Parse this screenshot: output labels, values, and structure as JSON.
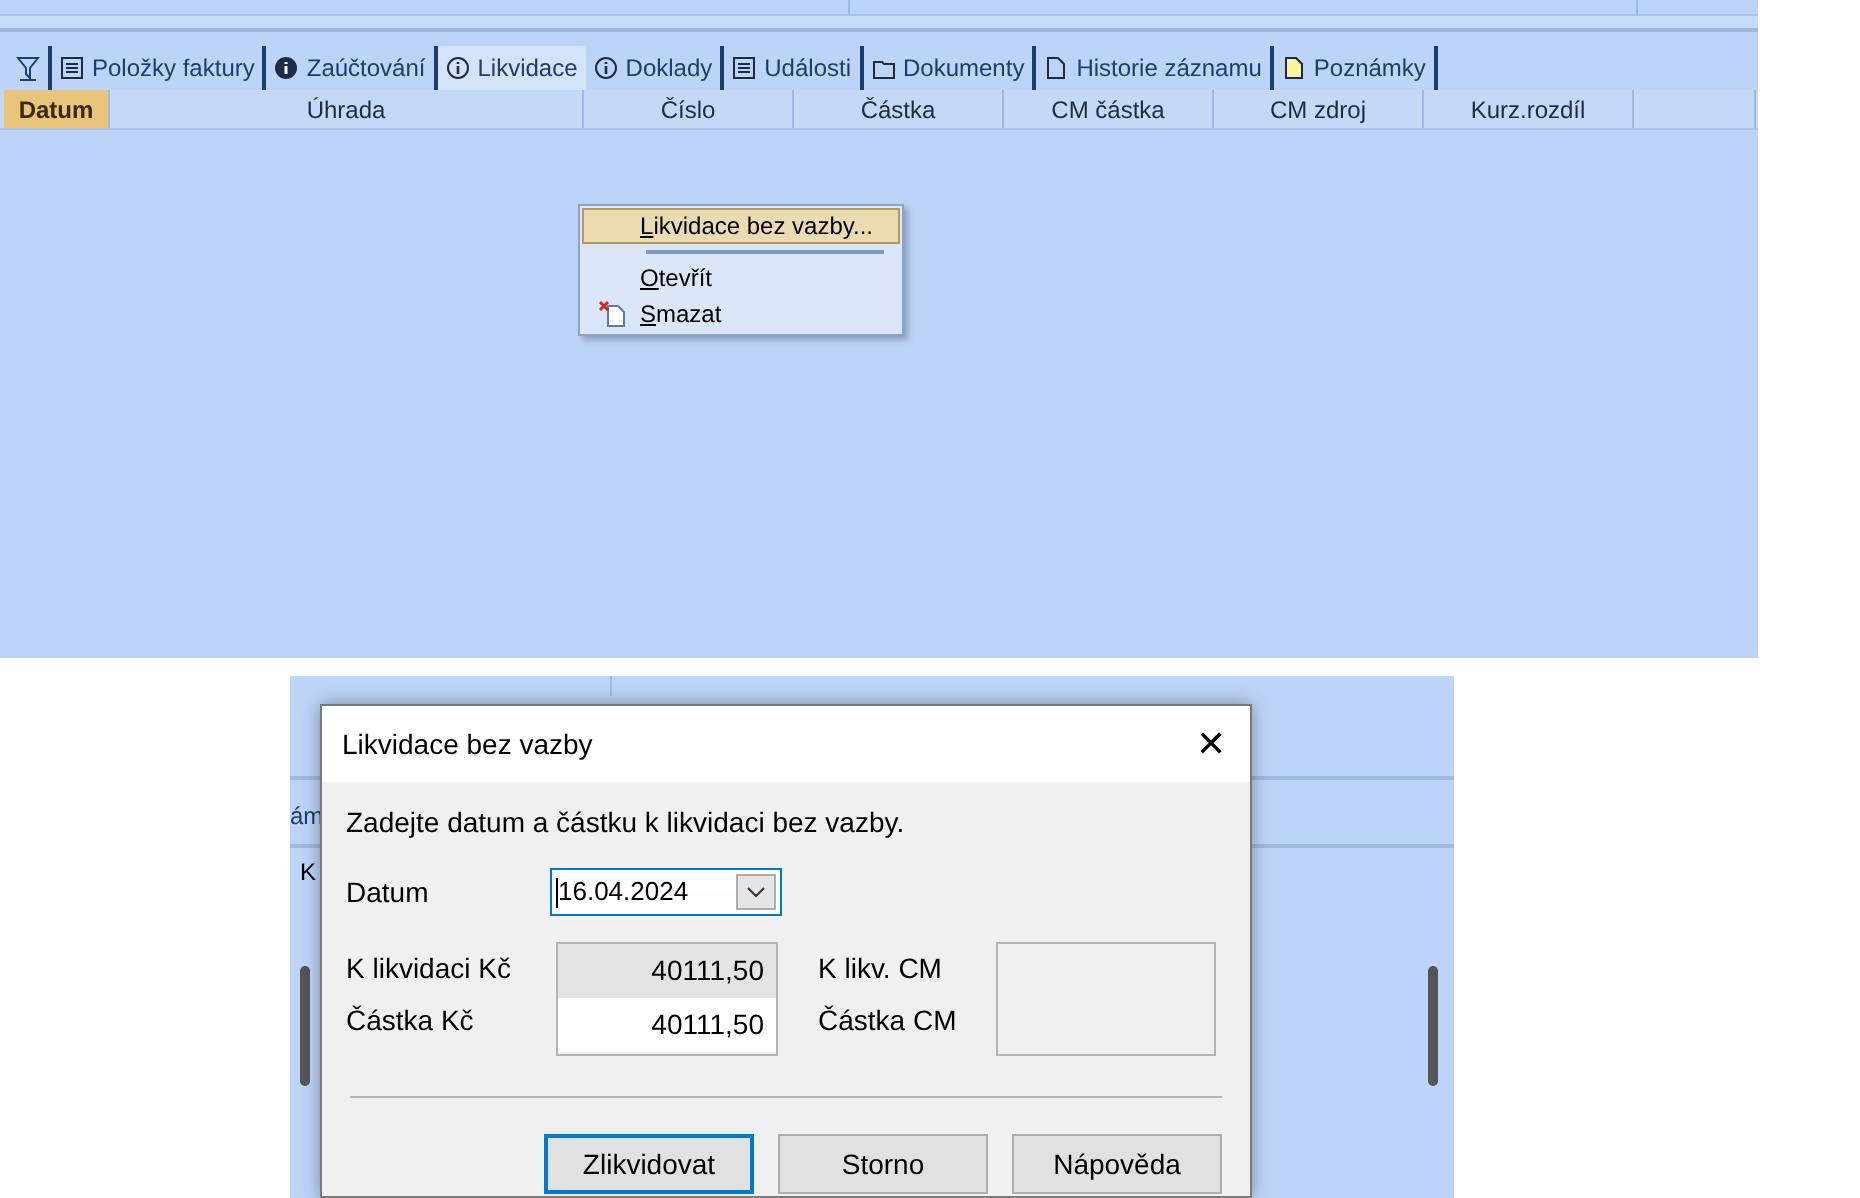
{
  "tabs": [
    {
      "kind": "filter",
      "selected": false
    },
    {
      "kind": "list",
      "label": "Položky faktury",
      "selected": false
    },
    {
      "kind": "info-solid",
      "label": "Zaúčtování",
      "selected": false
    },
    {
      "kind": "info",
      "label": "Likvidace",
      "selected": true
    },
    {
      "kind": "info",
      "label": "Doklady",
      "selected": false
    },
    {
      "kind": "list",
      "label": "Události",
      "selected": false
    },
    {
      "kind": "folder",
      "label": "Dokumenty",
      "selected": false
    },
    {
      "kind": "doc",
      "label": "Historie záznamu",
      "selected": false
    },
    {
      "kind": "note",
      "label": "Poznámky",
      "selected": false
    }
  ],
  "table": {
    "columns": [
      {
        "label": "Datum",
        "selected": true
      },
      {
        "label": "Úhrada",
        "selected": false
      },
      {
        "label": "Číslo",
        "selected": false
      },
      {
        "label": "Částka",
        "selected": false
      },
      {
        "label": "CM částka",
        "selected": false
      },
      {
        "label": "CM zdroj",
        "selected": false
      },
      {
        "label": "Kurz.rozdíl",
        "selected": false
      }
    ]
  },
  "context_menu": {
    "items": [
      {
        "kind": "plain",
        "label": "Likvidace bez vazby...",
        "selected": true
      },
      {
        "kind": "plain",
        "label": "Otevřít",
        "selected": false
      },
      {
        "kind": "delete",
        "label": "Smazat",
        "selected": false
      }
    ]
  },
  "background_fragments": [
    "ám",
    "K"
  ],
  "dialog": {
    "title": "Likvidace bez vazby",
    "close": "✕",
    "instruction": "Zadejte datum a částku k likvidaci bez vazby.",
    "date": {
      "label": "Datum",
      "value": "16.04.2024"
    },
    "amount_fields": [
      {
        "label": "K likvidaci Kč",
        "value": "40111,50",
        "disabled": true
      },
      {
        "label": "Částka Kč",
        "value": "40111,50",
        "disabled": false
      }
    ],
    "cm_fields": [
      {
        "label": "K likv. CM"
      },
      {
        "label": "Částka CM"
      }
    ],
    "buttons": [
      {
        "label": "Zlikvidovat",
        "default": true
      },
      {
        "label": "Storno",
        "default": false
      },
      {
        "label": "Nápověda",
        "default": false
      }
    ]
  }
}
